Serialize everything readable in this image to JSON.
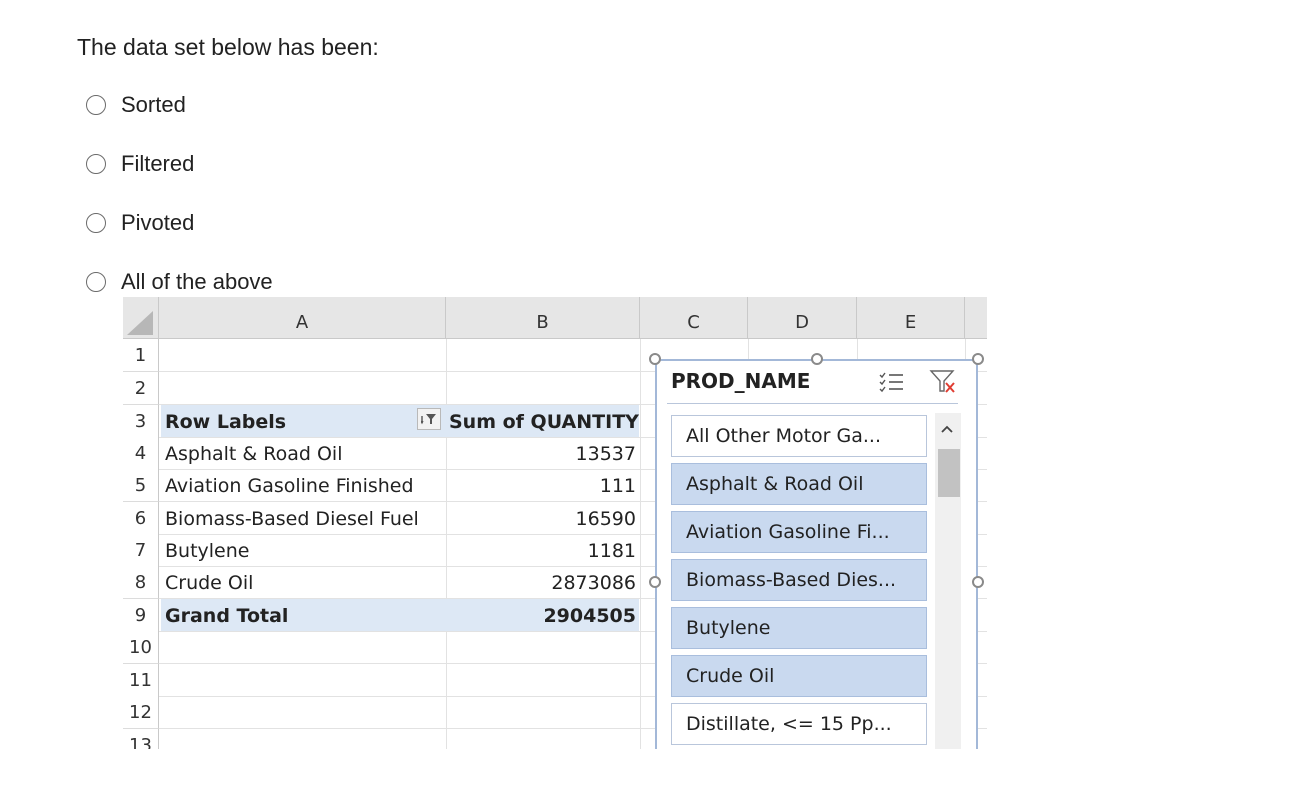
{
  "question": {
    "text": "The data set below has been:"
  },
  "options": [
    {
      "label": "Sorted"
    },
    {
      "label": "Filtered"
    },
    {
      "label": "Pivoted"
    },
    {
      "label": "All of the above"
    }
  ],
  "spreadsheet": {
    "columns": [
      "A",
      "B",
      "C",
      "D",
      "E"
    ],
    "row_numbers": [
      "1",
      "2",
      "3",
      "4",
      "5",
      "6",
      "7",
      "8",
      "9",
      "10",
      "11",
      "12",
      "13"
    ],
    "pivot": {
      "header_label": "Row Labels",
      "header_value": "Sum of QUANTITY",
      "rows": [
        {
          "label": "Asphalt & Road Oil",
          "value": "13537"
        },
        {
          "label": "Aviation Gasoline Finished",
          "value": "111"
        },
        {
          "label": "Biomass-Based Diesel Fuel",
          "value": "16590"
        },
        {
          "label": "Butylene",
          "value": "1181"
        },
        {
          "label": "Crude Oil",
          "value": "2873086"
        }
      ],
      "total_label": "Grand Total",
      "total_value": "2904505"
    },
    "slicer": {
      "title": "PROD_NAME",
      "items": [
        {
          "label": "All Other Motor Ga...",
          "selected": false
        },
        {
          "label": "Asphalt & Road Oil",
          "selected": true
        },
        {
          "label": "Aviation Gasoline Fi...",
          "selected": true
        },
        {
          "label": "Biomass-Based Dies...",
          "selected": true
        },
        {
          "label": "Butylene",
          "selected": true
        },
        {
          "label": "Crude Oil",
          "selected": true
        },
        {
          "label": "Distillate, <= 15 Pp...",
          "selected": false
        }
      ]
    }
  },
  "colors": {
    "pivot_header_bg": "#dde8f5",
    "slicer_selected_bg": "#c9d9ef",
    "slicer_border": "#a3b8d8",
    "clear_filter_x": "#e03c31"
  }
}
